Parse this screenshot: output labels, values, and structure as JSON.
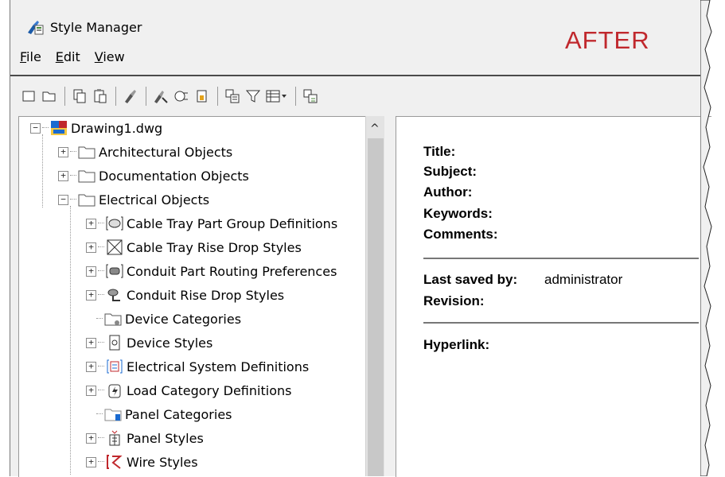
{
  "window": {
    "title": "Style Manager",
    "overlay_label": "AFTER"
  },
  "menu": [
    {
      "label": "File",
      "key": "F",
      "rest": "ile"
    },
    {
      "label": "Edit",
      "key": "E",
      "rest": "dit"
    },
    {
      "label": "View",
      "key": "V",
      "rest": "iew"
    }
  ],
  "toolbar": [
    "new-icon",
    "open-icon",
    "copy-icon",
    "paste-icon",
    "purge-icon",
    "edit-style-icon",
    "set-from-icon",
    "toggle-view-icon",
    "sort-icon",
    "filter-icon",
    "view-mode-icon",
    "sync-icon"
  ],
  "tree": {
    "root": "Drawing1.dwg",
    "categories": [
      "Architectural Objects",
      "Documentation Objects",
      "Electrical Objects"
    ],
    "electrical_items": [
      "Cable Tray Part Group Definitions",
      "Cable Tray Rise Drop Styles",
      "Conduit Part Routing Preferences",
      "Conduit Rise Drop Styles",
      "Device Categories",
      "Device Styles",
      "Electrical System Definitions",
      "Load Category Definitions",
      "Panel Categories",
      "Panel Styles",
      "Wire Styles"
    ]
  },
  "details": {
    "title_label": "Title:",
    "subject_label": "Subject:",
    "author_label": "Author:",
    "keywords_label": "Keywords:",
    "comments_label": "Comments:",
    "last_saved_label": "Last saved by:",
    "last_saved_value": "administrator",
    "revision_label": "Revision:",
    "hyperlink_label": "Hyperlink:"
  }
}
